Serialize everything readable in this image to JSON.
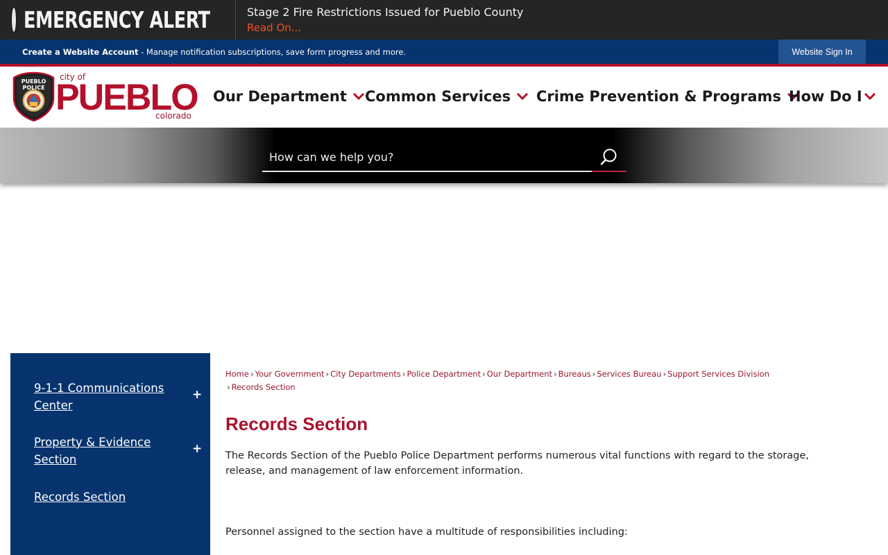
{
  "alert": {
    "title": "EMERGENCY ALERT",
    "headline": "Stage 2 Fire Restrictions Issued for Pueblo County",
    "read_on": "Read On..."
  },
  "account_bar": {
    "create_link": "Create a Website Account",
    "description": " - Manage notification subscriptions, save form progress and more.",
    "sign_in": "Website Sign In"
  },
  "logo": {
    "city_of": "city of",
    "name": "PUEBLO",
    "state": "colorado",
    "badge_text_top": "PUEBLO",
    "badge_text_bottom": "POLICE"
  },
  "nav": {
    "items": [
      {
        "label": "Our Department"
      },
      {
        "label": "Common Services"
      },
      {
        "label": "Crime Prevention & Programs"
      },
      {
        "label": "How Do I"
      }
    ]
  },
  "search": {
    "placeholder": "How can we help you?"
  },
  "sidebar": {
    "items": [
      {
        "label": "9-1-1 Communications Center",
        "expand": "+"
      },
      {
        "label": "Property & Evidence Section",
        "expand": "+"
      },
      {
        "label": "Records Section"
      }
    ]
  },
  "breadcrumb": {
    "items": [
      "Home",
      "Your Government",
      "City Departments",
      "Police Department",
      "Our Department",
      "Bureaus",
      "Services Bureau",
      "Support Services Division",
      "Records Section"
    ],
    "separator": "›"
  },
  "content": {
    "title": "Records Section",
    "paragraph1": "The Records Section of the Pueblo Police Department performs numerous vital functions with regard to the storage, release, and management of law enforcement information.",
    "paragraph2": "Personnel assigned to the section have a multitude of responsibilities including:"
  },
  "colors": {
    "brand_red": "#b3102b",
    "brand_blue": "#07346e",
    "alert_bg": "#252525",
    "alert_link": "#f0512a"
  }
}
